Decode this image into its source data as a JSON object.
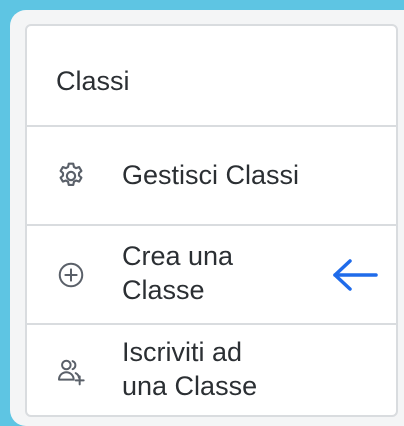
{
  "menu": {
    "title": "Classi",
    "items": [
      {
        "label": "Gestisci Classi",
        "icon": "gear-icon"
      },
      {
        "label": "Crea una\nClasse",
        "icon": "plus-circle-icon",
        "highlighted": true
      },
      {
        "label": "Iscriviti ad\nuna Classe",
        "icon": "user-add-icon"
      }
    ]
  },
  "colors": {
    "background": "#5ec5e3",
    "panel": "#f4f5f6",
    "card": "#ffffff",
    "border": "#d9dcdf",
    "text": "#2b2f33",
    "icon": "#5a6069",
    "arrow": "#1f6bea"
  }
}
